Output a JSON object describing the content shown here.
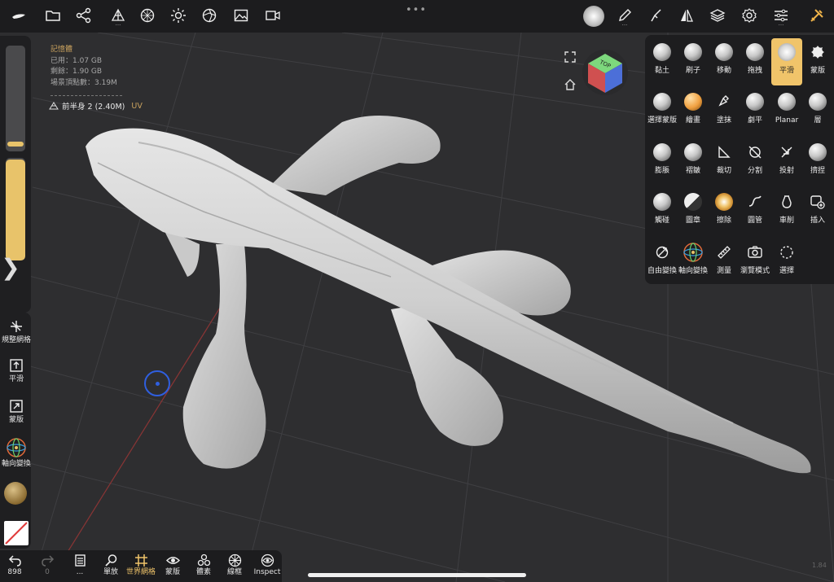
{
  "topbar": {
    "grip_label": "•••",
    "icons": [
      "sculpt-logo-icon",
      "folder-icon",
      "scene-graph-icon",
      "topology-icon",
      "background-icon",
      "light-icon",
      "postprocess-icon",
      "image-icon",
      "video-icon"
    ]
  },
  "stats": {
    "title": "記憶體",
    "used": "已用：1.07 GB",
    "free": "剩餘：1.90 GB",
    "vertices": "場景頂點數：3.19M",
    "mesh_name": "前半身 2 (2.40M)",
    "uv_badge": "UV"
  },
  "left_tools": {
    "remesh": "規整網格",
    "smooth": "平滑",
    "mask": "蒙版",
    "gizmo": "軸向變換"
  },
  "bottom_bar": {
    "undo_count": "898",
    "redo_count": "0",
    "more_dots": "...",
    "mirror": "單放",
    "world_grid": "世界網格",
    "mask": "蒙版",
    "voxel": "體素",
    "wireframe": "線框",
    "inspect": "Inspect"
  },
  "tools_panel": {
    "rows": [
      [
        {
          "label": "黏土",
          "icon": "clay-sphere"
        },
        {
          "label": "刷子",
          "icon": "brush-sphere"
        },
        {
          "label": "移動",
          "icon": "move-sphere"
        },
        {
          "label": "拖拽",
          "icon": "drag-sphere"
        },
        {
          "label": "平滑",
          "icon": "smooth-sphere",
          "selected": true
        },
        {
          "label": "蒙版",
          "icon": "mask-splat"
        }
      ],
      [
        {
          "label": "選擇蒙版",
          "icon": "select-mask-sphere"
        },
        {
          "label": "繪畫",
          "icon": "paint-sphere"
        },
        {
          "label": "塗抹",
          "icon": "smudge-icon"
        },
        {
          "label": "劇平",
          "icon": "flatten-sphere"
        },
        {
          "label": "Planar",
          "icon": "planar-sphere"
        },
        {
          "label": "層",
          "icon": "layer-sphere"
        }
      ],
      [
        {
          "label": "膨脹",
          "icon": "inflate-sphere"
        },
        {
          "label": "褶皺",
          "icon": "crease-sphere"
        },
        {
          "label": "裁切",
          "icon": "trim-icon"
        },
        {
          "label": "分割",
          "icon": "split-icon"
        },
        {
          "label": "投射",
          "icon": "project-icon"
        },
        {
          "label": "擠捏",
          "icon": "pinch-sphere"
        }
      ],
      [
        {
          "label": "觸碰",
          "icon": "twist-sphere"
        },
        {
          "label": "圖章",
          "icon": "stamp-sphere"
        },
        {
          "label": "擦除",
          "icon": "erase-sphere"
        },
        {
          "label": "圓管",
          "icon": "tube-icon"
        },
        {
          "label": "車削",
          "icon": "lathe-icon"
        },
        {
          "label": "插入",
          "icon": "insert-icon"
        }
      ],
      [
        {
          "label": "自由變換",
          "icon": "transform-icon"
        },
        {
          "label": "軸向變換",
          "icon": "gizmo-icon"
        },
        {
          "label": "測量",
          "icon": "ruler-icon"
        },
        {
          "label": "瀏覽模式",
          "icon": "camera-icon"
        },
        {
          "label": "選擇",
          "icon": "select-lasso-icon"
        }
      ]
    ]
  },
  "version": "1.84",
  "colors": {
    "accent": "#f0c46a",
    "bg": "#2b2b2d",
    "bar": "#1c1c1e",
    "gizmo": "#2f5fe0"
  }
}
